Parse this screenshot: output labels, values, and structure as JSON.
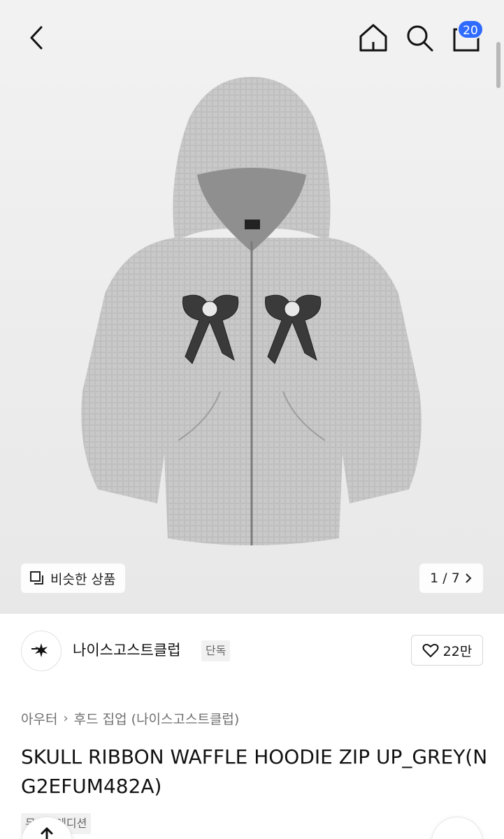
{
  "header": {
    "back_icon": "chevron-left-icon",
    "home_icon": "home-icon",
    "search_icon": "search-icon",
    "cart_icon": "shopping-bag-icon",
    "cart_count": "20",
    "badge_color": "#2f6bff"
  },
  "gallery": {
    "similar_label": "비슷한 상품",
    "similar_icon": "similar-products-icon",
    "counter": "1 / 7",
    "counter_icon": "chevron-right-icon"
  },
  "brand": {
    "logo_text": "niceghostclub",
    "name": "나이스고스트클럽",
    "tag": "단독",
    "like_icon": "heart-icon",
    "like_count": "22만"
  },
  "breadcrumb": {
    "category": "아우터",
    "subcategory": "후드 집업 (나이스고스트클럽)"
  },
  "product": {
    "title": "SKULL RIBBON WAFFLE HOODIE ZIP UP_GREY(NG2EFUM482A)",
    "badge": "무신사에디션"
  }
}
